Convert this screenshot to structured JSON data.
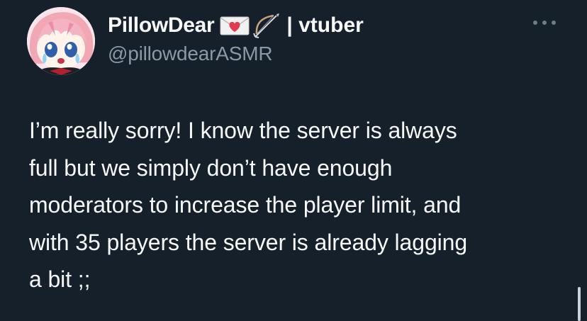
{
  "tweet": {
    "display_name": "PillowDear",
    "name_emojis": [
      "love-letter-icon",
      "bow-and-arrow-icon"
    ],
    "name_suffix": "| vtuber",
    "handle": "@pillowdearASMR",
    "text": "I’m really sorry! I know the server is always\nfull but we simply don’t have enough\nmoderators to increase the player limit, and\nwith 35 players the server is already lagging\na bit ;;"
  },
  "colors": {
    "background": "#15202b",
    "primary_text": "#f7f9f9",
    "secondary_text": "#8b98a5"
  },
  "icons": {
    "more": "more-horizontal-icon"
  }
}
